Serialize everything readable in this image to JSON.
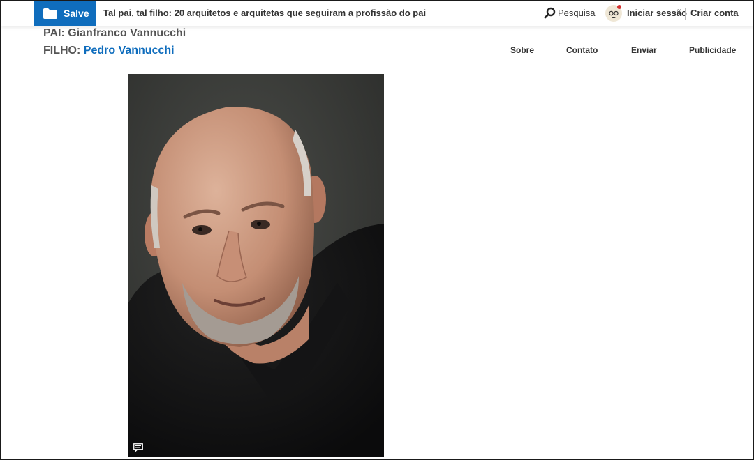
{
  "header": {
    "save_label": "Salve",
    "article_title": "Tal pai, tal filho: 20 arquitetos e arquitetas que seguiram a profissão do pai",
    "search_label": "Pesquisa",
    "signin_label": "Iniciar sessão",
    "signup_label": "Criar conta",
    "icons": {
      "save": "folder-icon",
      "search": "search-icon",
      "avatar": "avatar-icon"
    },
    "colors": {
      "brand": "#0f6dbd",
      "notification_dot": "#d32f2f"
    }
  },
  "credits": {
    "father_prefix": "PAI:",
    "father_name": "Gianfranco Vannucchi",
    "son_prefix": "FILHO:",
    "son_name": "Pedro Vannucchi"
  },
  "nav": {
    "items": [
      {
        "label": "Sobre"
      },
      {
        "label": "Contato"
      },
      {
        "label": "Enviar"
      },
      {
        "label": "Publicidade"
      }
    ]
  },
  "photo": {
    "comment_icon": "comment-icon"
  }
}
